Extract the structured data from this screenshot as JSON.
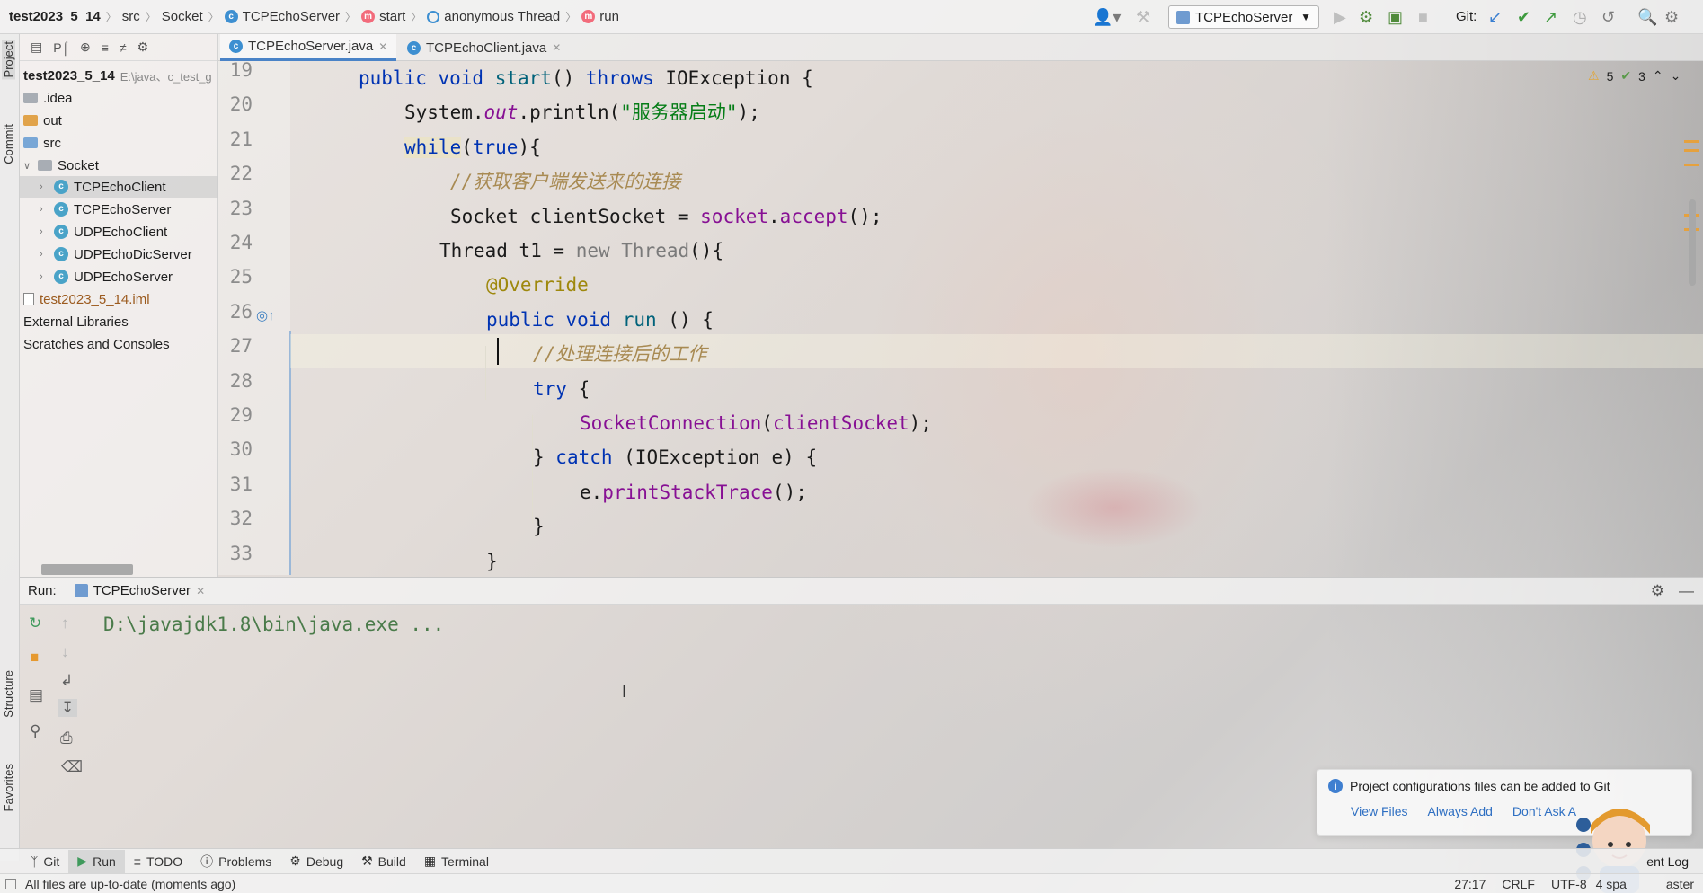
{
  "breadcrumb": {
    "project": "test2023_5_14",
    "src": "src",
    "pkg": "Socket",
    "cls": "TCPEchoServer",
    "method": "start",
    "anon": "anonymous Thread",
    "run": "run"
  },
  "toolbar": {
    "run_config": "TCPEchoServer",
    "git_label": "Git:"
  },
  "sidebar_tabs": {
    "project": "Project",
    "commit": "Commit",
    "structure": "Structure",
    "favorites": "Favorites"
  },
  "project_panel": {
    "toolbar_label": "P⌠",
    "root": {
      "name": "test2023_5_14",
      "path": "E:\\java、c_test_g"
    },
    "items": [
      {
        "label": ".idea"
      },
      {
        "label": "out"
      },
      {
        "label": "src"
      },
      {
        "label": "Socket"
      },
      {
        "label": "TCPEchoClient"
      },
      {
        "label": "TCPEchoServer"
      },
      {
        "label": "UDPEchoClient"
      },
      {
        "label": "UDPEchoDicServer"
      },
      {
        "label": "UDPEchoServer"
      },
      {
        "label": "test2023_5_14.iml"
      },
      {
        "label": "External Libraries"
      },
      {
        "label": "Scratches and Consoles"
      }
    ]
  },
  "editor": {
    "tabs": [
      {
        "label": "TCPEchoServer.java"
      },
      {
        "label": "TCPEchoClient.java"
      }
    ],
    "warnings": "5",
    "weak_warnings": "3",
    "line_numbers": [
      "19",
      "20",
      "21",
      "22",
      "23",
      "24",
      "25",
      "26",
      "27",
      "28",
      "29",
      "30",
      "31",
      "32",
      "33"
    ]
  },
  "run_panel": {
    "title": "Run:",
    "tab": "TCPEchoServer",
    "output": "D:\\javajdk1.8\\bin\\java.exe ..."
  },
  "bottom_tabs": [
    {
      "label": "Git"
    },
    {
      "label": "Run"
    },
    {
      "label": "TODO"
    },
    {
      "label": "Problems"
    },
    {
      "label": "Debug"
    },
    {
      "label": "Build"
    },
    {
      "label": "Terminal"
    }
  ],
  "status": {
    "message": "All files are up-to-date (moments ago)",
    "position": "27:17",
    "line_sep": "CRLF",
    "encoding": "UTF-8",
    "indent": "4 spa",
    "branch": "aster",
    "event_log": "ent Log"
  },
  "notification": {
    "text": "Project configurations files can be added to Git",
    "view": "View Files",
    "always": "Always Add",
    "dont": "Don't Ask A"
  },
  "colors": {
    "keyword": "#0033b3",
    "string": "#067d17",
    "comment": "#8c8c8c",
    "annotation": "#9e880d",
    "field": "#871094",
    "accent": "#4a83c7"
  }
}
